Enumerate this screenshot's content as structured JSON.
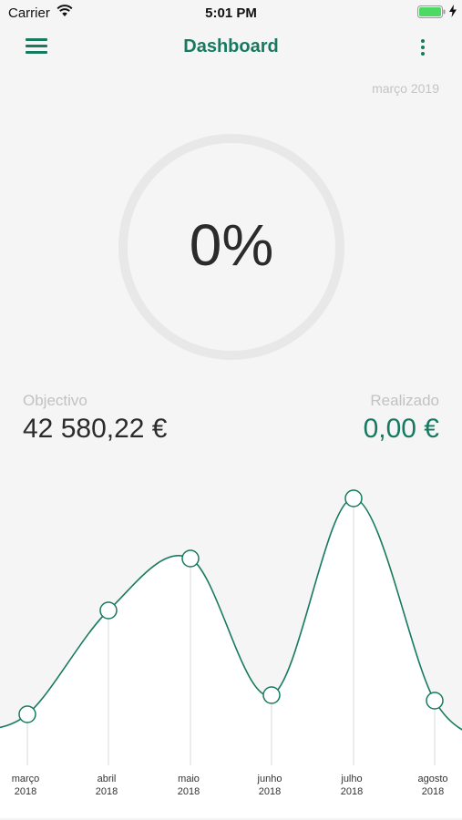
{
  "status_bar": {
    "carrier": "Carrier",
    "time": "5:01 PM"
  },
  "nav": {
    "title": "Dashboard",
    "menu_icon": "hamburger-icon",
    "more_icon": "more-vertical-icon"
  },
  "period": "março 2019",
  "progress": {
    "text": "0%",
    "value": 0
  },
  "objective": {
    "label": "Objectivo",
    "value": "42 580,22 €"
  },
  "realized": {
    "label": "Realizado",
    "value": "0,00 €"
  },
  "colors": {
    "accent": "#177a60",
    "background": "#f5f5f5"
  },
  "chart_data": {
    "type": "area",
    "categories": [
      "março 2018",
      "abril 2018",
      "maio 2018",
      "junho 2018",
      "julho 2018",
      "agosto 2018"
    ],
    "tick_labels": [
      [
        "março",
        "2018"
      ],
      [
        "abril",
        "2018"
      ],
      [
        "maio",
        "2018"
      ],
      [
        "junho",
        "2018"
      ],
      [
        "julho",
        "2018"
      ],
      [
        "agosto",
        "2018"
      ]
    ],
    "values": [
      1.2,
      5.0,
      6.9,
      1.9,
      9.1,
      1.7
    ],
    "ylim": [
      0,
      10
    ],
    "grid": false,
    "legend": "none"
  }
}
